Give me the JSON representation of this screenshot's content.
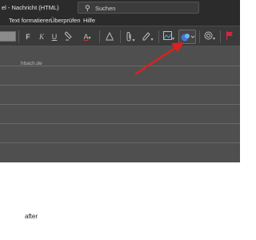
{
  "titlebar": {
    "title": "el - Nachricht (HTML)",
    "search_placeholder": "Suchen",
    "search_icon": "search-icon"
  },
  "menubar": {
    "items": [
      "Text formatieren",
      "Überprüfen",
      "Hilfe"
    ]
  },
  "ribbon": {
    "bold": "F",
    "italic": "K",
    "underline": "U",
    "font_color": "A",
    "icons": [
      "format-painter-icon",
      "highlight-icon",
      "font-color-icon",
      "attach-icon",
      "signature-icon",
      "designer-icon",
      "sensitivity-icon",
      "flag-icon"
    ]
  },
  "header_fields": {
    "recipient_fragment": "hbach.de"
  },
  "body": {
    "text_fragment": "after"
  },
  "annotation": {
    "arrow_color": "#e0201c"
  },
  "colors": {
    "dark_chrome": "#2b2b2b",
    "ribbon": "#3a3a3a",
    "header_panel": "#4f4f4f",
    "flag_red": "#d9253f"
  }
}
